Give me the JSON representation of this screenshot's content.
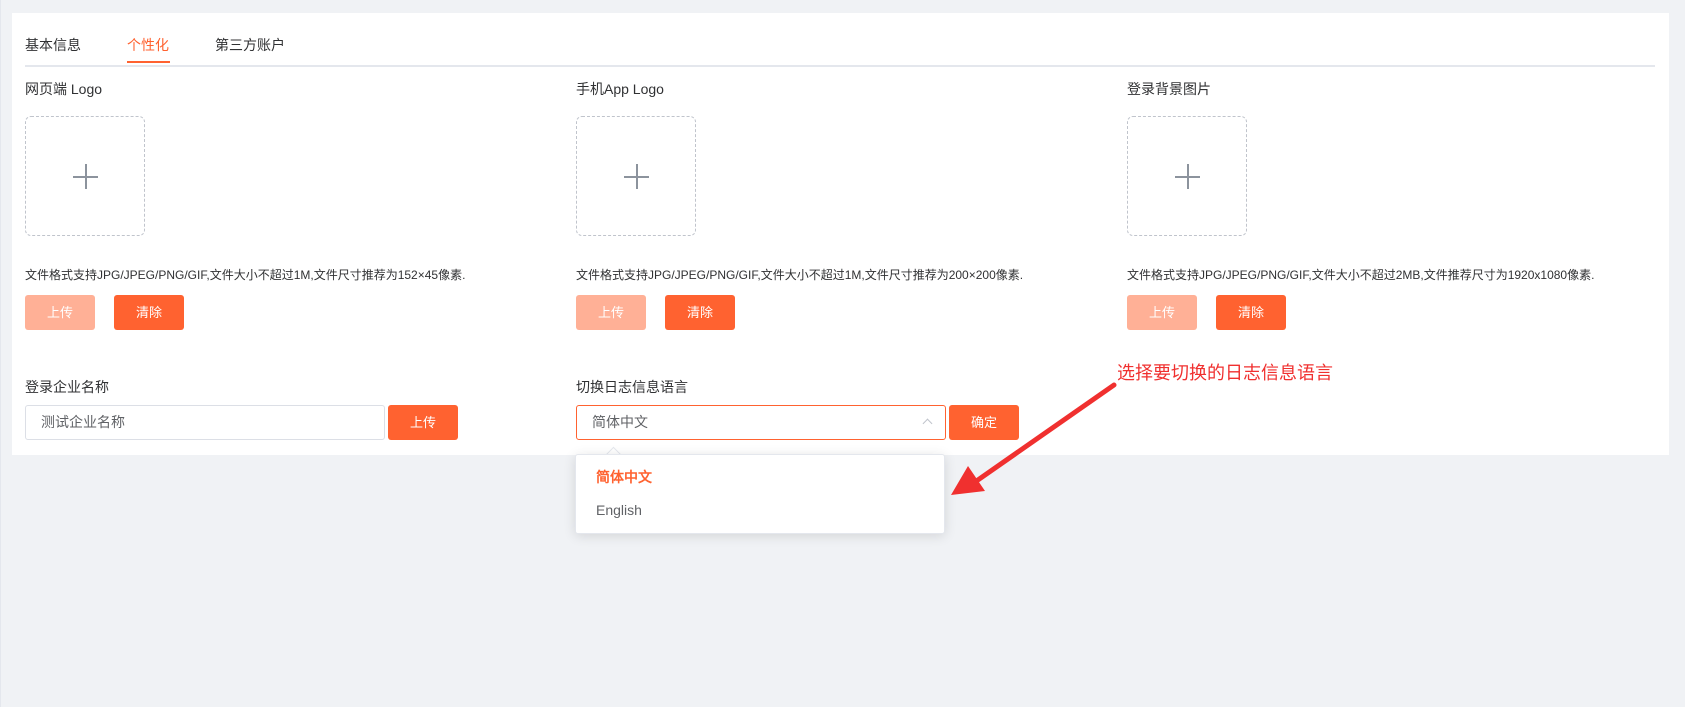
{
  "tabs": [
    {
      "label": "基本信息",
      "active": false
    },
    {
      "label": "个性化",
      "active": true
    },
    {
      "label": "第三方账户",
      "active": false
    }
  ],
  "web_logo": {
    "title": "网页端 Logo",
    "hint": "文件格式支持JPG/JPEG/PNG/GIF,文件大小不超过1M,文件尺寸推荐为152×45像素.",
    "upload_label": "上传",
    "clear_label": "清除"
  },
  "app_logo": {
    "title": "手机App Logo",
    "hint": "文件格式支持JPG/JPEG/PNG/GIF,文件大小不超过1M,文件尺寸推荐为200×200像素.",
    "upload_label": "上传",
    "clear_label": "清除"
  },
  "login_bg": {
    "title": "登录背景图片",
    "hint": "文件格式支持JPG/JPEG/PNG/GIF,文件大小不超过2MB,文件推荐尺寸为1920x1080像素.",
    "upload_label": "上传",
    "clear_label": "清除"
  },
  "company_name": {
    "label": "登录企业名称",
    "value": "测试企业名称",
    "button_label": "上传"
  },
  "log_language": {
    "label": "切换日志信息语言",
    "selected": "简体中文",
    "confirm_label": "确定",
    "options": [
      "简体中文",
      "English"
    ]
  },
  "annotation": {
    "text": "选择要切换的日志信息语言"
  },
  "colors": {
    "accent": "#ff6230",
    "accent_disabled": "#ffb096",
    "annotation": "#f0302f",
    "background": "#f0f2f5"
  }
}
